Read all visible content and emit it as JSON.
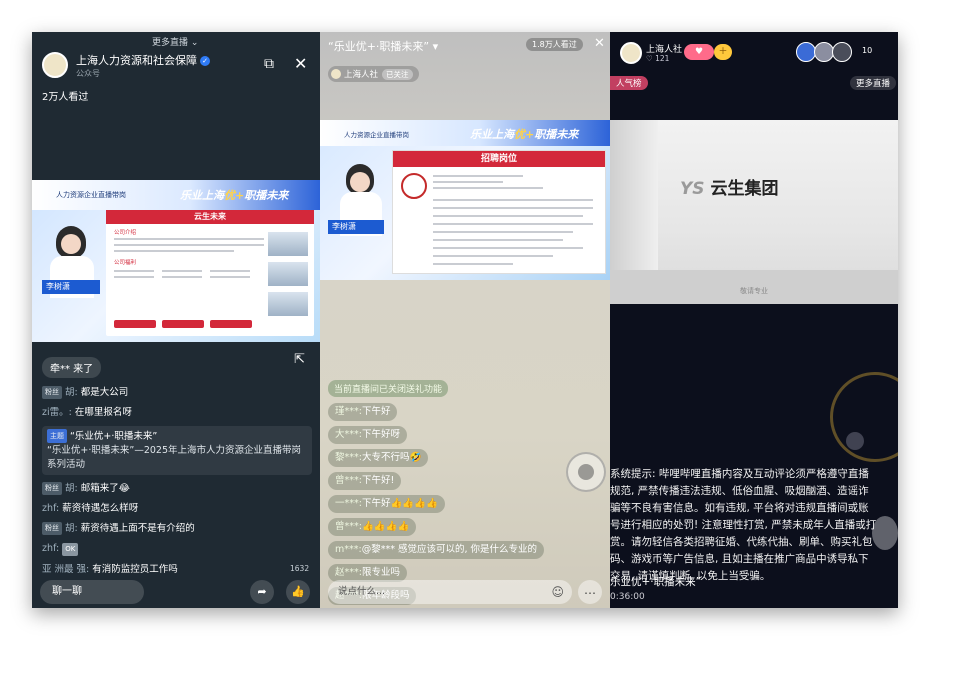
{
  "panel1": {
    "more_live": "更多直播",
    "account_name": "上海人力资源和社会保障",
    "account_sub": "公众号",
    "viewers": "2万人看过",
    "video": {
      "org_banner": "人力资源企业直播带岗",
      "slogan_a": "乐业上海",
      "slogan_b": "优+",
      "slogan_c": "职播未来",
      "card_title": "云生未来",
      "section_a": "公司介绍",
      "section_b": "公司福利",
      "host_name": "李树潇"
    },
    "join_notice": "牵** 来了",
    "chat": [
      {
        "badge": "粉丝",
        "user": "胡:",
        "text": "都是大公司"
      },
      {
        "badge": "",
        "user": "zi雷。:",
        "text": "在哪里报名呀"
      },
      {
        "badge": "粉丝",
        "user": "胡:",
        "text": "邮箱来了😂"
      },
      {
        "badge": "",
        "user": "zhf:",
        "text": "薪资待遇怎么样呀"
      },
      {
        "badge": "粉丝",
        "user": "胡:",
        "text": "薪资待遇上面不是有介绍的"
      },
      {
        "badge": "",
        "user": "zhf:",
        "text": "OK"
      },
      {
        "badge": "",
        "user": "亚 洲最 强:",
        "text": "有消防监控员工作吗"
      }
    ],
    "topic": {
      "badge": "主题",
      "title": "“乐业优+·职播未来”",
      "desc": "“乐业优+·职播未来”—2025年上海市人力资源企业直播带岗系列活动"
    },
    "like_count": "1632",
    "chat_button": "聊一聊"
  },
  "panel2": {
    "title": "“乐业优+·职播未来”",
    "views": "1.8万人看过",
    "account": "上海人社",
    "followed": "已关注",
    "video": {
      "org_banner": "人力资源企业直播带岗",
      "slogan_a": "乐业上海",
      "slogan_b": "优+",
      "slogan_c": "职播未来",
      "card_title": "招聘岗位",
      "host_name": "李树潇"
    },
    "gift_notice": "当前直播间已关闭送礼功能",
    "chat": [
      {
        "user": "瑾***:",
        "text": "下午好"
      },
      {
        "user": "大***:",
        "text": "下午好呀"
      },
      {
        "user": "黎***:",
        "text": "大专不行吗🤣"
      },
      {
        "user": "曾***:",
        "text": "下午好!"
      },
      {
        "user": "一***:",
        "text": "下午好👍👍👍👍"
      },
      {
        "user": "曾***:",
        "text": "👍👍👍👍"
      },
      {
        "user": "m***:",
        "text": "@黎*** 感觉应该可以的, 你是什么专业的"
      },
      {
        "user": "赵***:",
        "text": "限专业吗"
      },
      {
        "user": "赵***:",
        "text": "限年龄段吗"
      }
    ],
    "input_placeholder": "说点什么..."
  },
  "panel3": {
    "account": "上海人社",
    "likes": "121",
    "viewer_count": "10",
    "popularity": "人气榜",
    "more_live": "更多直播",
    "company": "云生集团",
    "company_prefix": "YS",
    "watermark": "敬请专业",
    "system_notice": "系统提示: 哔哩哔哩直播内容及互动评论须严格遵守直播规范, 严禁传播违法违规、低俗血腥、吸烟酗酒、造谣诈骗等不良有害信息。如有违规, 平台将对违规直播间或账号进行相应的处罚! 注意理性打赏, 严禁未成年人直播或打赏。请勿轻信各类招聘征婚、代练代抽、刷单、购买礼包码、游戏币等广告信息, 且如主播在推广商品中诱导私下交易, 请谨慎判断, 以免上当受骗。",
    "topic": "乐业优+·职播未来”",
    "time": "0:36:00"
  },
  "colors": {
    "accent_red": "#d3283a",
    "accent_blue": "#1c5bd1",
    "dark_bg": "#1f2a33"
  }
}
